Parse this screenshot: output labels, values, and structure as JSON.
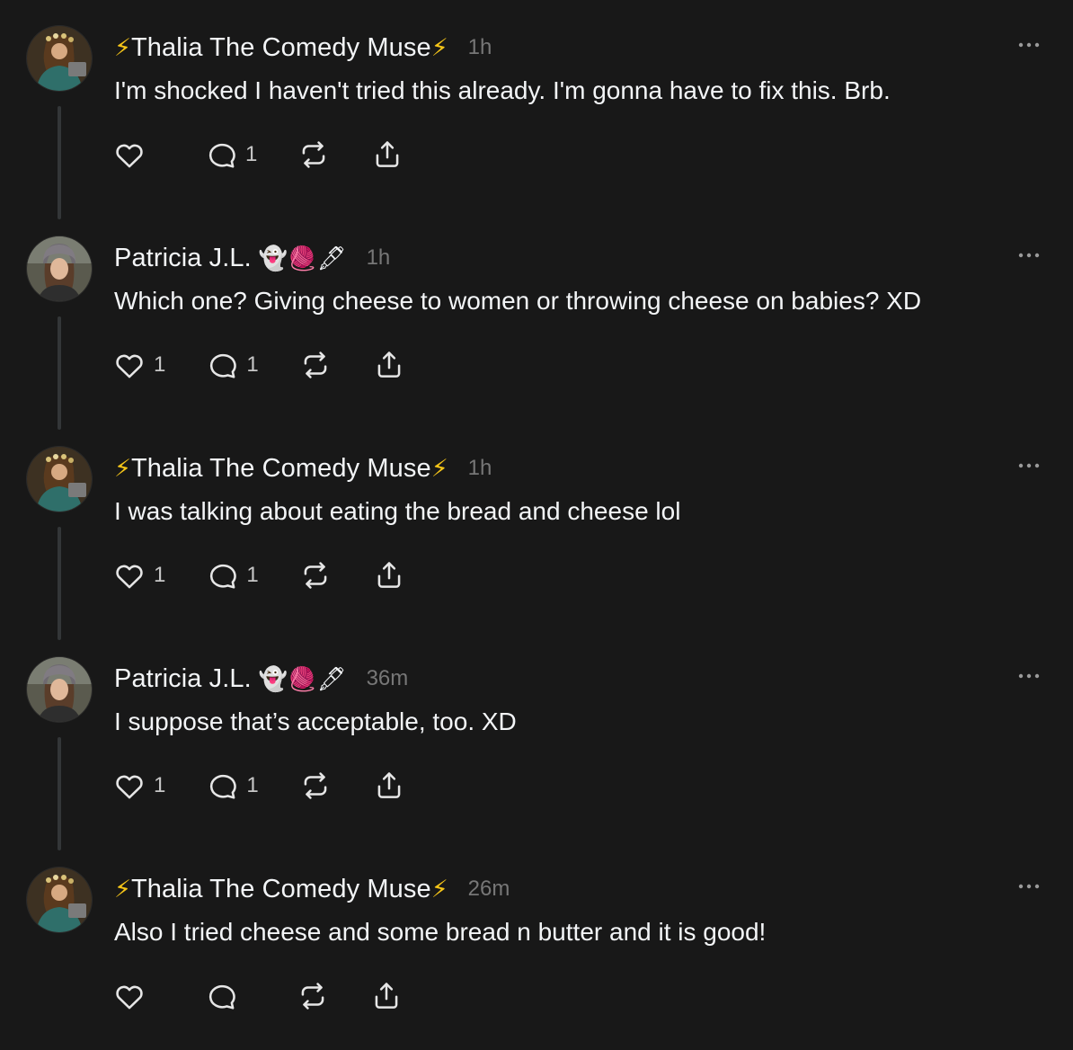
{
  "posts": [
    {
      "author": "Thalia The Comedy Muse",
      "author_prefix": "⚡",
      "author_suffix": "⚡",
      "badges": "",
      "time": "1h",
      "text": "I'm shocked I haven't tried this already. I'm gonna have to fix this. Brb.",
      "likes": "",
      "replies": "1"
    },
    {
      "author": "Patricia J.L.",
      "author_prefix": "",
      "author_suffix": "",
      "badges": "👻🧶🖋",
      "time": "1h",
      "text": "Which one? Giving cheese to women or throwing cheese on babies? XD",
      "likes": "1",
      "replies": "1"
    },
    {
      "author": "Thalia The Comedy Muse",
      "author_prefix": "⚡",
      "author_suffix": "⚡",
      "badges": "",
      "time": "1h",
      "text": "I was talking about eating the bread and cheese lol",
      "likes": "1",
      "replies": "1"
    },
    {
      "author": "Patricia J.L.",
      "author_prefix": "",
      "author_suffix": "",
      "badges": "👻🧶🖋",
      "time": "36m",
      "text": "I suppose that’s acceptable, too. XD",
      "likes": "1",
      "replies": "1"
    },
    {
      "author": "Thalia The Comedy Muse",
      "author_prefix": "⚡",
      "author_suffix": "⚡",
      "badges": "",
      "time": "26m",
      "text": "Also I tried cheese and some bread n butter and it is good!",
      "likes": "",
      "replies": ""
    }
  ],
  "icons": {
    "like": "heart-icon",
    "reply": "comment-icon",
    "repost": "repost-icon",
    "share": "share-icon",
    "more": "more-icon"
  },
  "colors": {
    "background": "#181818",
    "text": "#f3f5f7",
    "muted": "#777777",
    "thread_line": "#333638",
    "bolt": "#f5c518"
  }
}
